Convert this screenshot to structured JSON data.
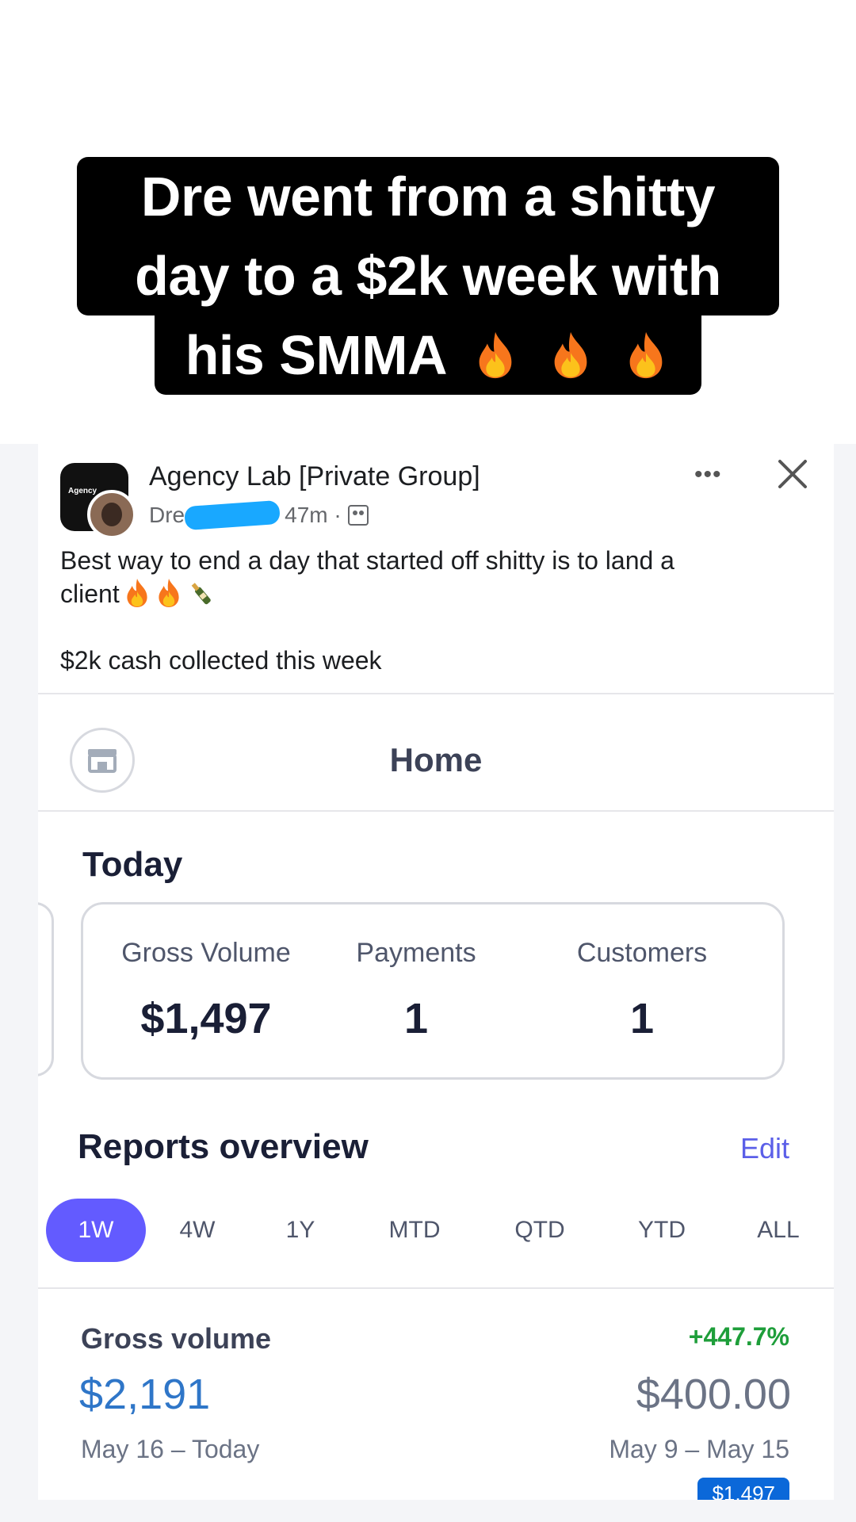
{
  "caption": {
    "line1": "Dre went from a shitty",
    "line2": "day to a $2k week with",
    "line3": "his SMMA"
  },
  "post": {
    "group_name": "Agency Lab [Private Group]",
    "author": "Dre",
    "time": "47m ·",
    "text_line1": "Best way to end a day that started off shitty is to land a",
    "text_line2": "client",
    "text_line3": "$2k cash collected this week",
    "logo_text": "Agency"
  },
  "app": {
    "title": "Home",
    "today_label": "Today",
    "stats": [
      {
        "label": "Gross Volume",
        "value": "$1,497"
      },
      {
        "label": "Payments",
        "value": "1"
      },
      {
        "label": "Customers",
        "value": "1"
      }
    ],
    "reports_title": "Reports overview",
    "edit_label": "Edit",
    "tabs": [
      "1W",
      "4W",
      "1Y",
      "MTD",
      "QTD",
      "YTD",
      "ALL"
    ],
    "active_tab": "1W",
    "gross_volume": {
      "label": "Gross volume",
      "change": "+447.7%",
      "value": "$2,191",
      "previous_value": "$400.00",
      "range": "May 16 – Today",
      "previous_range": "May 9 – May 15",
      "badge": "$1,497"
    },
    "accent_color": "#635bff",
    "link_color": "#5b5fe8",
    "positive_color": "#1e9e3a"
  }
}
